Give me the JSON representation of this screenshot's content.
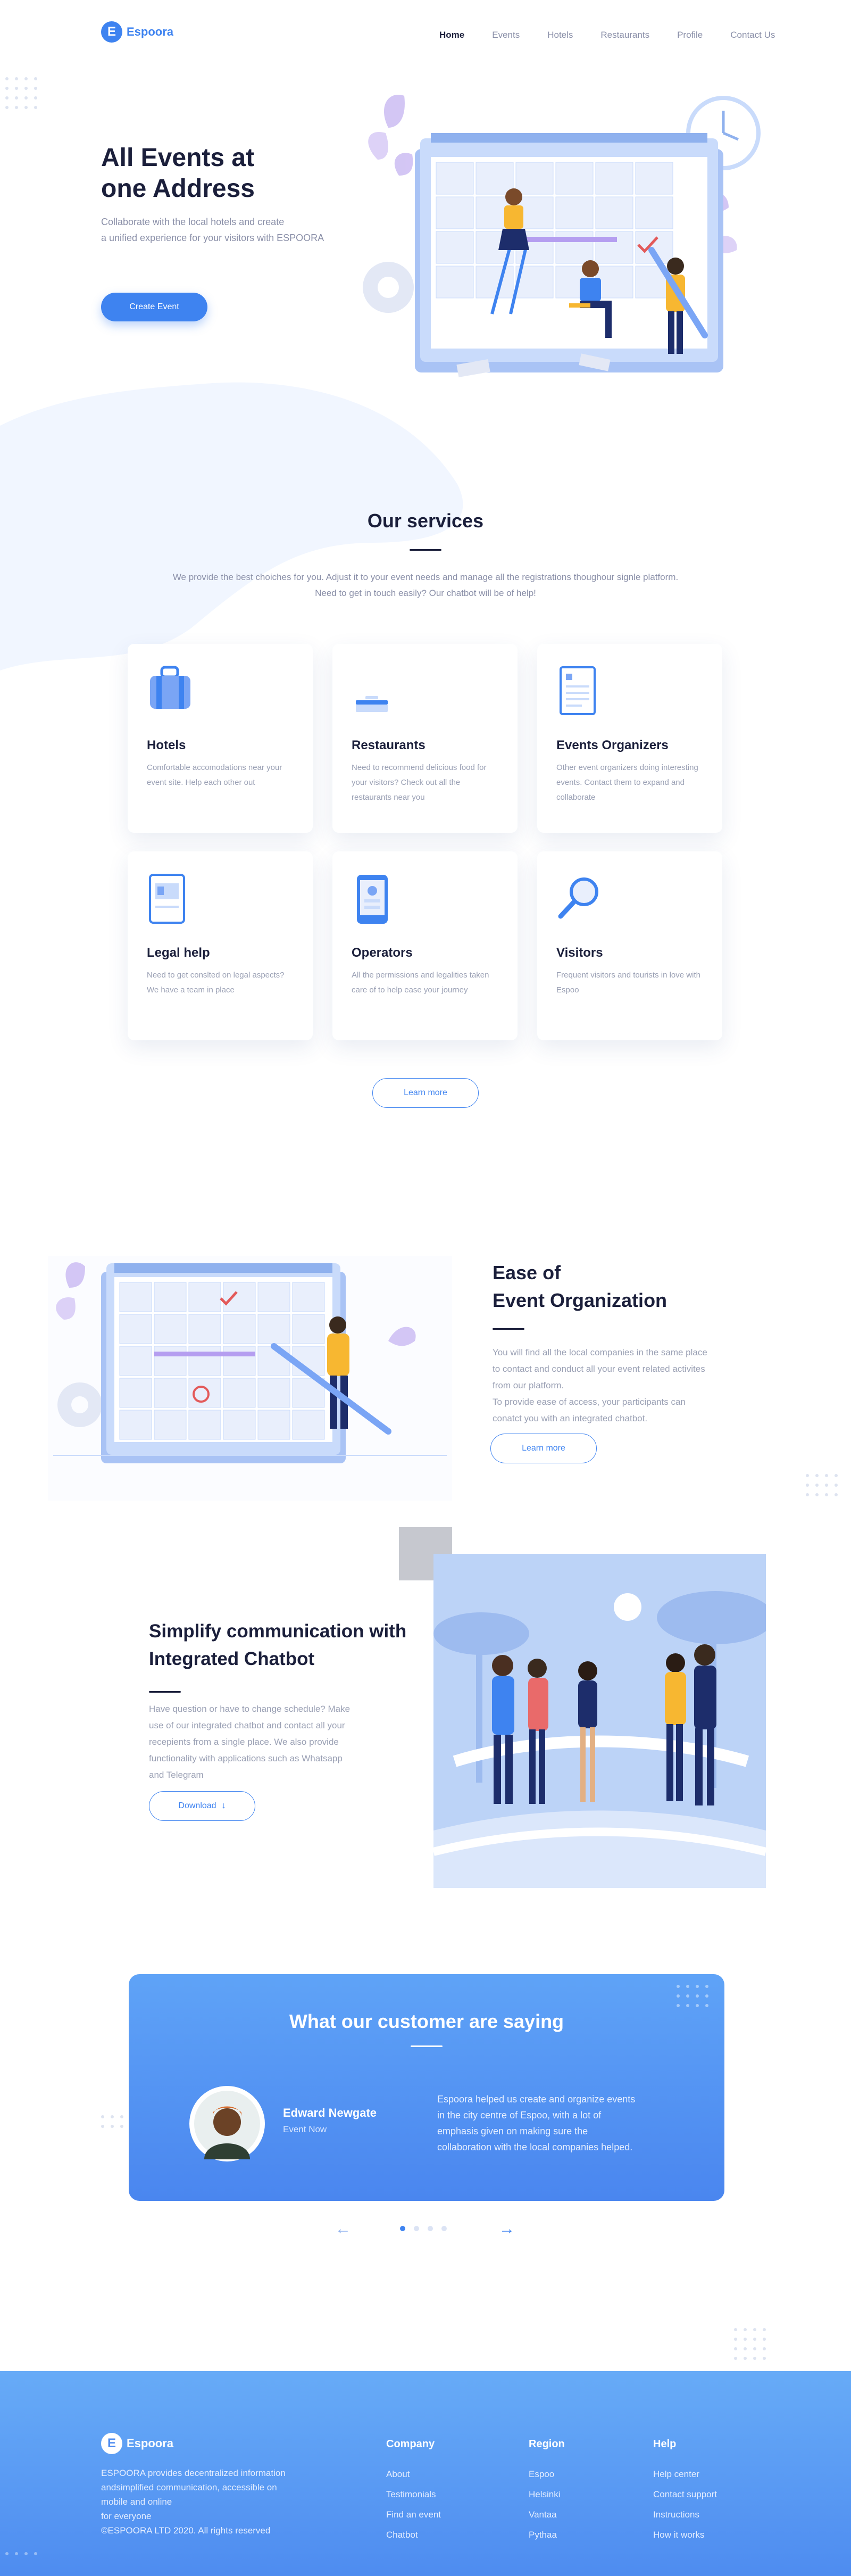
{
  "brand": {
    "logo_letter": "E",
    "name": "Espoora"
  },
  "nav": {
    "items": [
      "Home",
      "Events",
      "Hotels",
      "Restaurants",
      "Profile",
      "Contact Us"
    ]
  },
  "hero": {
    "title": "All Events at\none Address",
    "subtitle": "Collaborate with the local hotels and create\na unified experience for your visitors with ESPOORA",
    "cta": "Create Event"
  },
  "services": {
    "title": "Our services",
    "intro": "We provide the best choiches for you. Adjust it to your event needs and manage all the registrations thoughour signle platform. Need to get in touch easily? Our chatbot will be of help!",
    "cards": [
      {
        "icon": "suitcase-icon",
        "title": "Hotels",
        "text": "Comfortable accomodations near your event site. Help each other out"
      },
      {
        "icon": "dining-tray-icon",
        "title": "Restaurants",
        "text": "Need to recommend delicious food for your visitors? Check out all the restaurants near you"
      },
      {
        "icon": "document-icon",
        "title": "Events Organizers",
        "text": "Other event organizers doing interesting events. Contact them to expand and collaborate"
      },
      {
        "icon": "id-card-icon",
        "title": "Legal help",
        "text": "Need to get conslted on legal aspects? We have a team in place"
      },
      {
        "icon": "phone-icon",
        "title": "Operators",
        "text": "All the permissions and legalities taken care of to help ease your journey"
      },
      {
        "icon": "magnifier-icon",
        "title": "Visitors",
        "text": "Frequent visitors and tourists in love with Espoo"
      }
    ],
    "more": "Learn more"
  },
  "ease": {
    "title": "Ease  of\nEvent Organization",
    "text": "You will find all the local companies in the same place\nto contact and conduct all your event related activites\nfrom our platform.\nTo provide ease of access,  your participants can\nconatct you with an integrated chatbot.",
    "button": "Learn more"
  },
  "chatbot": {
    "title": "Simplify communication with\nIntegrated Chatbot",
    "text": "Have question or have to change schedule? Make\nuse of our integrated chatbot and contact all your\nrecepients from a single place. We also provide\nfunctionality with applications such as Whatsapp\nand Telegram",
    "button": "Download"
  },
  "testimonials": {
    "title": "What our customer are saying",
    "name": "Edward Newgate",
    "role": "Event Now",
    "quote": "Espoora helped us create and organize events\nin the city centre of Espoo, with a lot of\nemphasis given on making sure the\ncollaboration with the local companies helped.",
    "pages": 4,
    "active_page": 0
  },
  "footer": {
    "description": "ESPOORA provides decentralized information\nandsimplified communication, accessible on\nmobile and online\nfor everyone\n©ESPOORA LTD 2020. All rights reserved",
    "columns": [
      {
        "title": "Company",
        "links": [
          "About",
          "Testimonials",
          "Find an event",
          "Chatbot"
        ]
      },
      {
        "title": "Region",
        "links": [
          "Espoo",
          "Helsinki",
          "Vantaa",
          "Pythaa"
        ]
      },
      {
        "title": "Help",
        "links": [
          "Help center",
          "Contact support",
          "Instructions",
          "How it works"
        ]
      }
    ]
  },
  "colors": {
    "accent": "#3e83f0",
    "dark": "#1b1f3b",
    "muted": "#8a8fa8",
    "yellow": "#f7b731",
    "light_blue": "#c9dbfb"
  }
}
